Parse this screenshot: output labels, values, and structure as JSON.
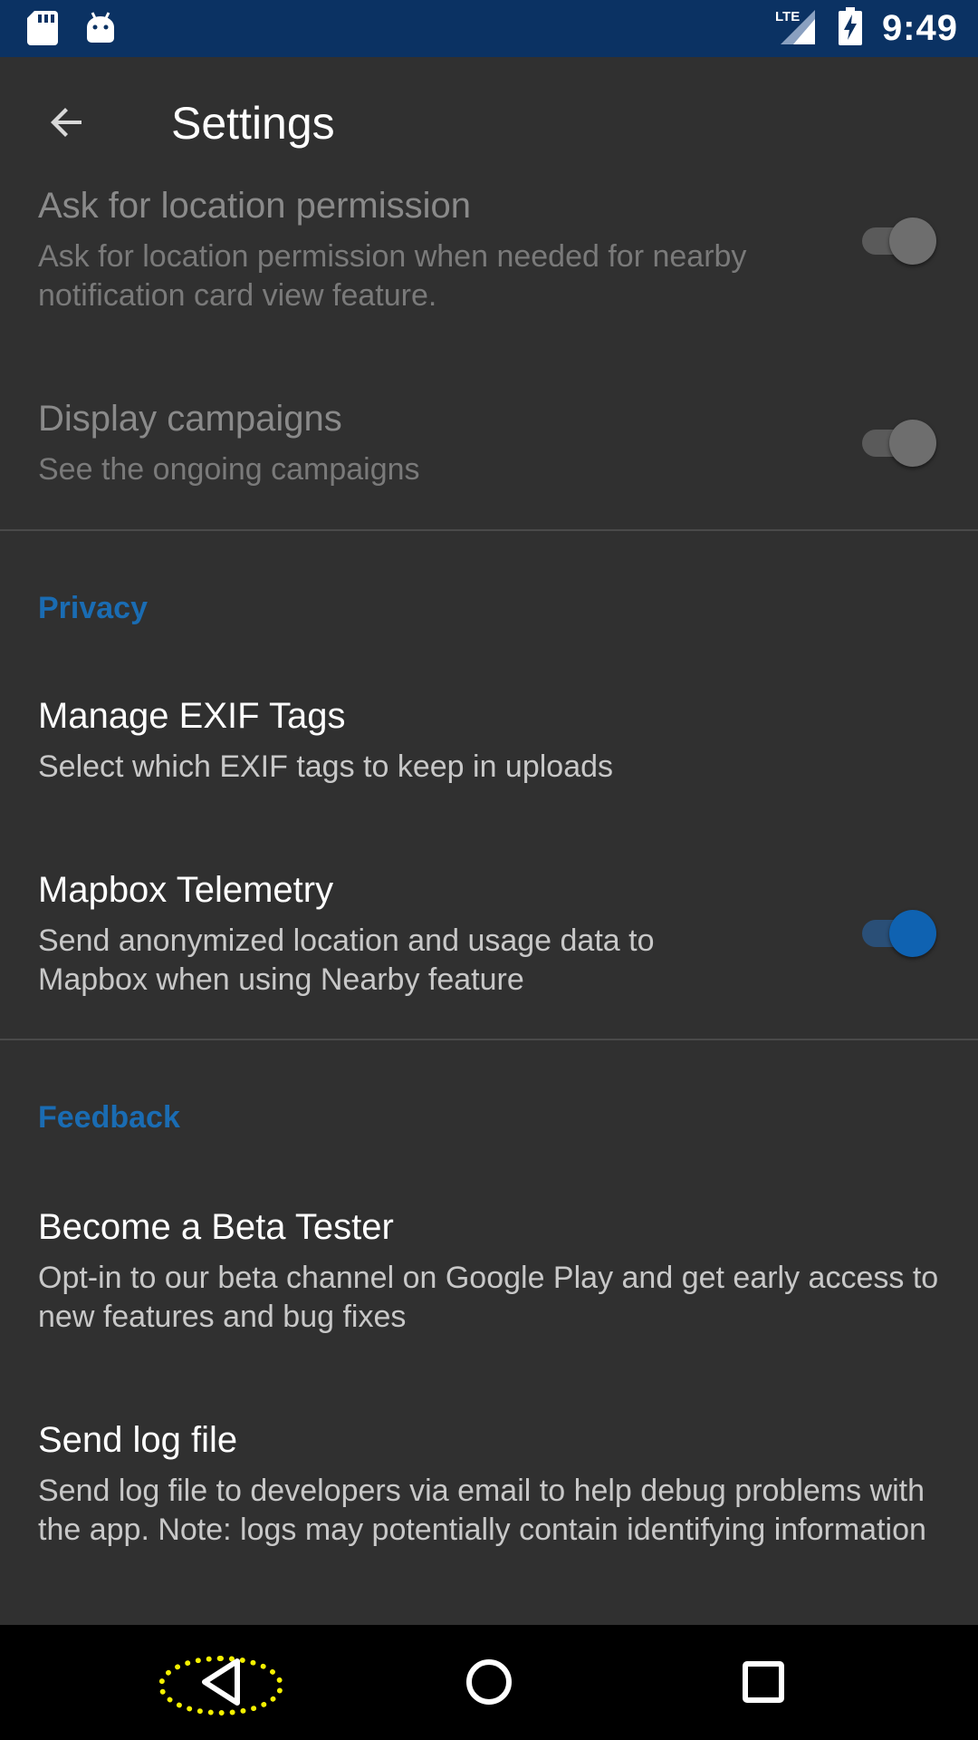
{
  "status_bar": {
    "time": "9:49",
    "network": "LTE",
    "icons": [
      "sd-card-icon",
      "android-icon",
      "lte-signal-icon",
      "battery-charging-icon"
    ]
  },
  "app_bar": {
    "title": "Settings",
    "back_icon": "arrow-back-icon"
  },
  "preferences": {
    "location_permission": {
      "title": "Ask for location permission",
      "summary": "Ask for location permission when needed for nearby notification card view feature.",
      "enabled": false,
      "checked": true
    },
    "display_campaigns": {
      "title": "Display campaigns",
      "summary": "See the ongoing campaigns",
      "enabled": false,
      "checked": true
    }
  },
  "privacy": {
    "category": "Privacy",
    "exif": {
      "title": "Manage EXIF Tags",
      "summary": "Select which EXIF tags to keep in uploads"
    },
    "telemetry": {
      "title": "Mapbox Telemetry",
      "summary": "Send anonymized location and usage data to Mapbox when using Nearby feature",
      "checked": true
    }
  },
  "feedback": {
    "category": "Feedback",
    "beta": {
      "title": "Become a Beta Tester",
      "summary": "Opt-in to our beta channel on Google Play and get early access to new features and bug fixes"
    },
    "log": {
      "title": "Send log file",
      "summary": "Send log file to developers via email to help debug problems with the app. Note: logs may potentially contain identifying information"
    }
  },
  "nav_bar": {
    "buttons": [
      "back-nav-icon",
      "home-nav-icon",
      "recents-nav-icon"
    ],
    "highlight_color": "#f4f000"
  },
  "colors": {
    "status_bar": "#0b3263",
    "background": "#303030",
    "accent": "#1a6cb3",
    "toggle_on": "#0f62b1"
  }
}
